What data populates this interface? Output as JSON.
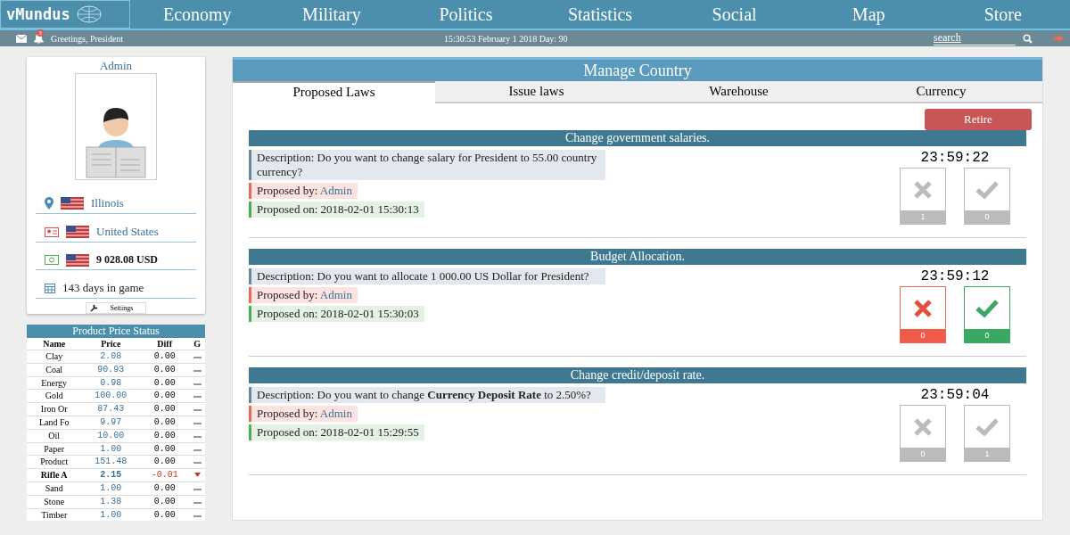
{
  "nav": {
    "logo": "vMundus",
    "items": [
      "Economy",
      "Military",
      "Politics",
      "Statistics",
      "Social",
      "Map",
      "Store"
    ]
  },
  "subbar": {
    "notifications": "3",
    "greeting": "Greetings, President",
    "datetime": "15:30:53 February 1 2018  Day: 90",
    "search": {
      "placeholder": "search"
    }
  },
  "profile": {
    "name": "Admin",
    "region": "Illinois",
    "country": "United States",
    "money": "9 028.08 USD",
    "days": "143 days in game",
    "settings": "Settings"
  },
  "prices": {
    "title": "Product Price Status",
    "columns": [
      "Name",
      "Price",
      "Diff",
      "G"
    ],
    "rows": [
      {
        "name": "Clay",
        "price": "2.08",
        "diff": "0.00",
        "falling": false
      },
      {
        "name": "Coal",
        "price": "90.93",
        "diff": "0.00",
        "falling": false
      },
      {
        "name": "Energy",
        "price": "0.98",
        "diff": "0.00",
        "falling": false
      },
      {
        "name": "Gold",
        "price": "100.00",
        "diff": "0.00",
        "falling": false
      },
      {
        "name": "Iron Or",
        "price": "87.43",
        "diff": "0.00",
        "falling": false
      },
      {
        "name": "Land Fo",
        "price": "9.97",
        "diff": "0.00",
        "falling": false
      },
      {
        "name": "Oil",
        "price": "10.00",
        "diff": "0.00",
        "falling": false
      },
      {
        "name": "Paper",
        "price": "1.00",
        "diff": "0.00",
        "falling": false
      },
      {
        "name": "Product",
        "price": "151.48",
        "diff": "0.00",
        "falling": false
      },
      {
        "name": "Rifle A",
        "price": "2.15",
        "diff": "-0.01",
        "falling": true
      },
      {
        "name": "Sand",
        "price": "1.00",
        "diff": "0.00",
        "falling": false
      },
      {
        "name": "Stone",
        "price": "1.38",
        "diff": "0.00",
        "falling": false
      },
      {
        "name": "Timber",
        "price": "1.00",
        "diff": "0.00",
        "falling": false
      }
    ]
  },
  "panel": {
    "title": "Manage Country",
    "tabs": [
      {
        "label": "Proposed Laws",
        "selected": true
      },
      {
        "label": "Issue laws",
        "selected": false
      },
      {
        "label": "Warehouse",
        "selected": false
      },
      {
        "label": "Currency",
        "selected": false
      }
    ],
    "retire": "Retire",
    "laws": [
      {
        "title": "Change government salaries.",
        "description": "Description: Do you want to change salary for President to 55.00 country currency?",
        "proposed_by_label": "Proposed by:",
        "proposed_by": "Admin",
        "proposed_on": "Proposed on: 2018-02-01 15:30:13",
        "timer": "23:59:22",
        "voting_enabled": false,
        "votes_against": "1",
        "votes_for": "0"
      },
      {
        "title": "Budget Allocation.",
        "description": "Description: Do you want to allocate 1 000.00 US Dollar for President?",
        "proposed_by_label": "Proposed by:",
        "proposed_by": "Admin",
        "proposed_on": "Proposed on: 2018-02-01 15:30:03",
        "timer": "23:59:12",
        "voting_enabled": true,
        "votes_against": "0",
        "votes_for": "0"
      },
      {
        "title": "Change credit/deposit rate.",
        "description": "Description: Do you want to change **Currency Deposit Rate** to 2.50%?",
        "proposed_by_label": "Proposed by:",
        "proposed_by": "Admin",
        "proposed_on": "Proposed on: 2018-02-01 15:29:55",
        "timer": "23:59:04",
        "voting_enabled": false,
        "votes_against": "0",
        "votes_for": "1"
      }
    ]
  }
}
